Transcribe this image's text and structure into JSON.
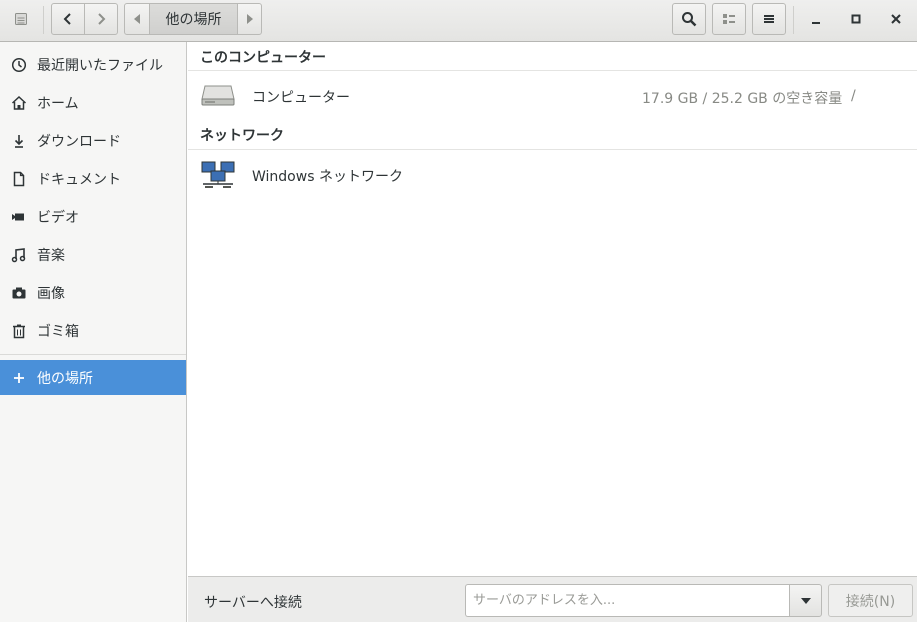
{
  "header": {
    "location_label": "他の場所"
  },
  "sidebar": {
    "items": [
      {
        "label": "最近開いたファイル",
        "icon": "clock-icon"
      },
      {
        "label": "ホーム",
        "icon": "home-icon"
      },
      {
        "label": "ダウンロード",
        "icon": "download-icon"
      },
      {
        "label": "ドキュメント",
        "icon": "document-icon"
      },
      {
        "label": "ビデオ",
        "icon": "video-icon"
      },
      {
        "label": "音楽",
        "icon": "music-icon"
      },
      {
        "label": "画像",
        "icon": "camera-icon"
      },
      {
        "label": "ゴミ箱",
        "icon": "trash-icon"
      }
    ],
    "other_locations": {
      "label": "他の場所",
      "icon": "plus-icon"
    },
    "accent": "#4a90d9"
  },
  "main": {
    "computer_section": {
      "title": "このコンピューター",
      "item": {
        "label": "コンピューター",
        "space": "17.9 GB / 25.2 GB の空き容量",
        "path": "/"
      }
    },
    "network_section": {
      "title": "ネットワーク",
      "item": {
        "label": "Windows ネットワーク"
      }
    }
  },
  "bottom": {
    "label": "サーバーへ接続",
    "placeholder": "サーバのアドレスを入...",
    "connect_label": "接続(N)"
  }
}
